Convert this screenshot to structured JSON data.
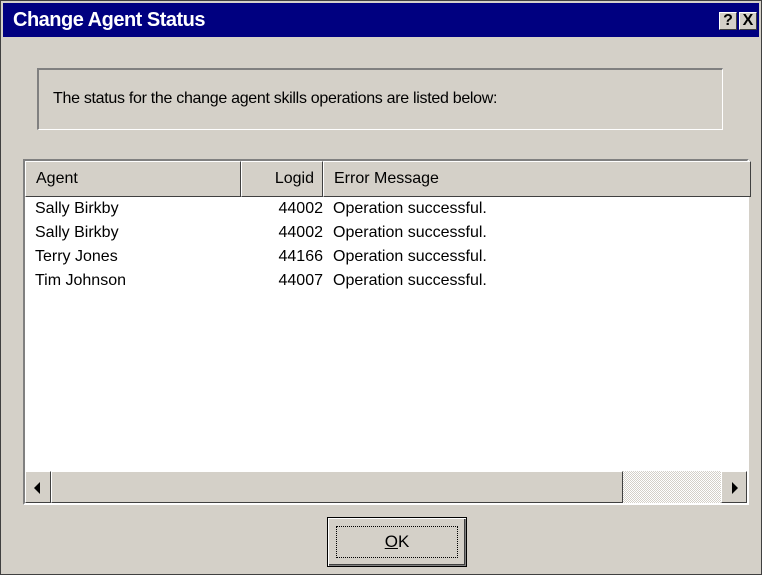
{
  "window": {
    "title": "Change Agent Status",
    "help_glyph": "?",
    "close_glyph": "X"
  },
  "message": "The status for the change agent skills operations are listed below:",
  "list": {
    "columns": [
      "Agent",
      "Logid",
      "Error Message"
    ],
    "rows": [
      {
        "agent": "Sally Birkby",
        "logid": "44002",
        "error": "Operation successful."
      },
      {
        "agent": "Sally Birkby",
        "logid": "44002",
        "error": "Operation successful."
      },
      {
        "agent": "Terry Jones",
        "logid": "44166",
        "error": "Operation successful."
      },
      {
        "agent": "Tim Johnson",
        "logid": "44007",
        "error": "Operation successful."
      }
    ]
  },
  "buttons": {
    "ok_mnemonic": "O",
    "ok_rest": "K"
  },
  "colors": {
    "titlebar": "#000080",
    "dialog_face": "#d4d0c8"
  }
}
